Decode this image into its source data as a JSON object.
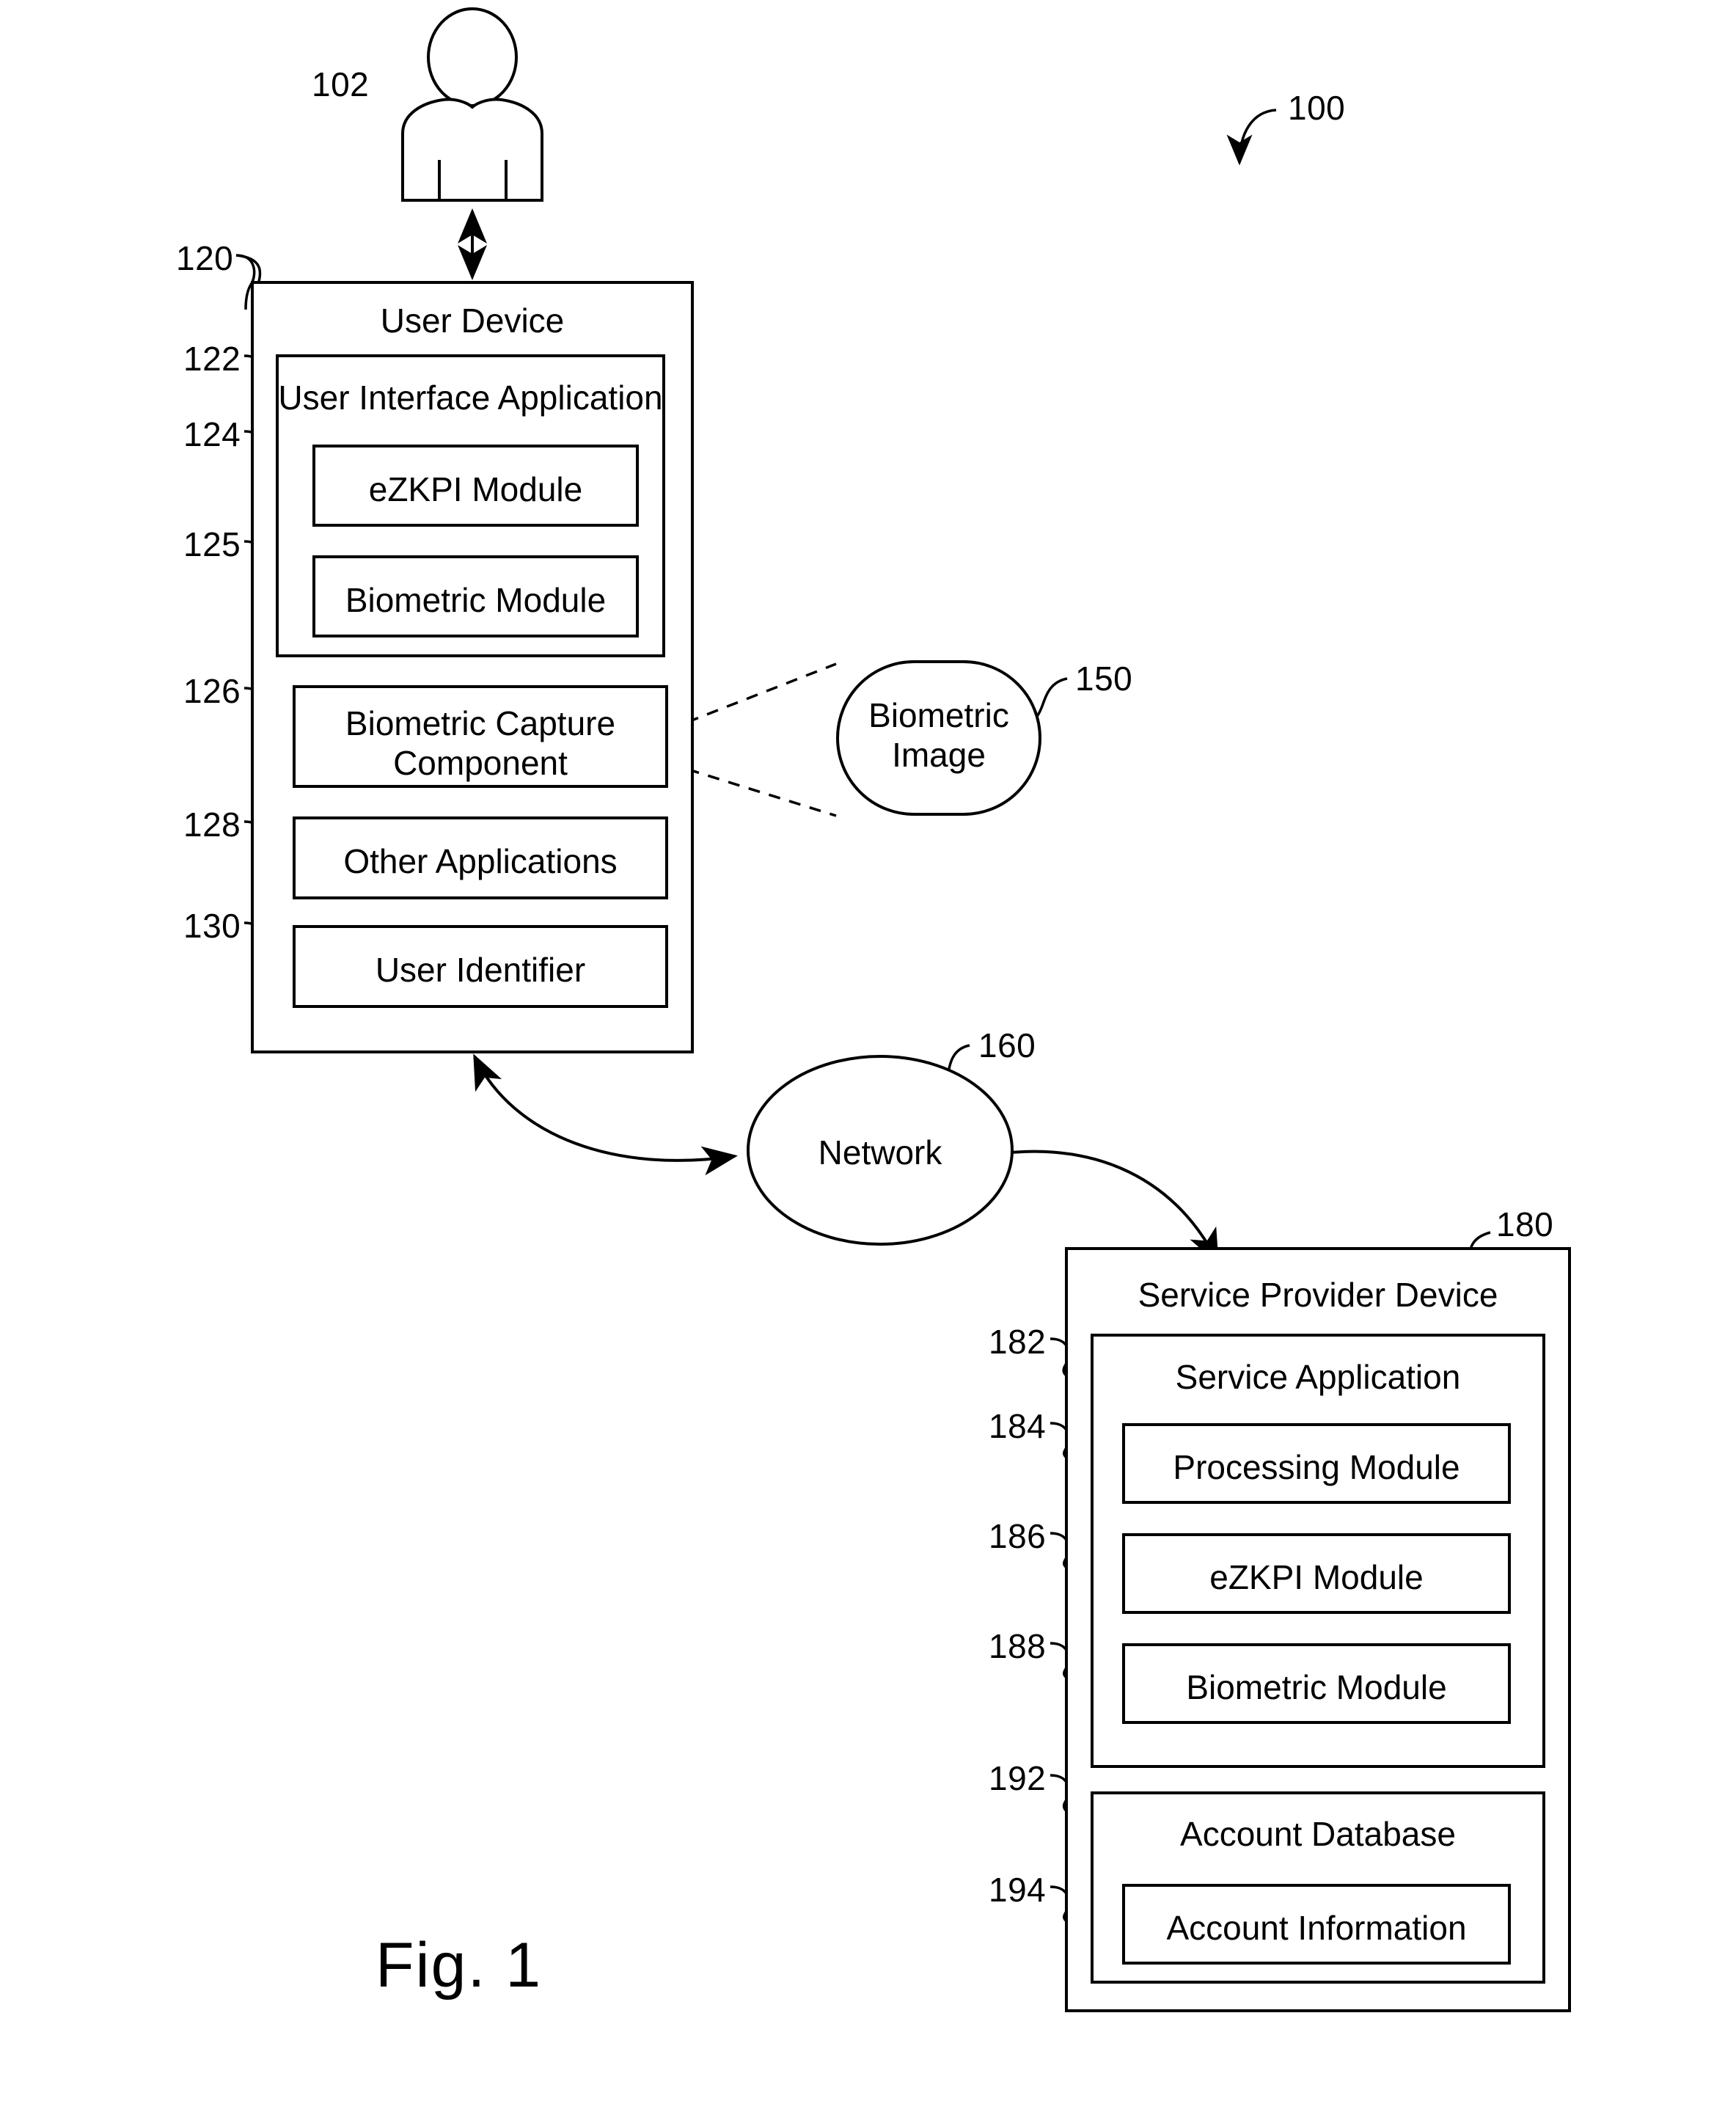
{
  "figure": {
    "caption": "Fig. 1",
    "system_ref": "100"
  },
  "actor": {
    "ref": "102",
    "name": "user-person"
  },
  "user_device": {
    "ref": "120",
    "title": "User Device",
    "user_interface_application": {
      "ref": "122",
      "title": "User Interface Application",
      "modules": [
        {
          "ref": "124",
          "label": "eZKPI Module"
        },
        {
          "ref": "125",
          "label": "Biometric Module"
        }
      ]
    },
    "components": [
      {
        "ref": "126",
        "label": "Biometric Capture\nComponent"
      },
      {
        "ref": "128",
        "label": "Other Applications"
      },
      {
        "ref": "130",
        "label": "User Identifier"
      }
    ]
  },
  "biometric_image": {
    "ref": "150",
    "label": "Biometric\nImage"
  },
  "network": {
    "ref": "160",
    "label": "Network"
  },
  "service_provider_device": {
    "ref": "180",
    "title": "Service Provider Device",
    "service_application": {
      "ref": "182",
      "title": "Service Application",
      "modules": [
        {
          "ref": "184",
          "label": "Processing Module"
        },
        {
          "ref": "186",
          "label": "eZKPI Module"
        },
        {
          "ref": "188",
          "label": "Biometric Module"
        }
      ]
    },
    "account_database": {
      "ref": "192",
      "title": "Account Database",
      "items": [
        {
          "ref": "194",
          "label": "Account Information"
        }
      ]
    }
  },
  "colors": {
    "stroke": "#000000",
    "background": "#ffffff"
  }
}
